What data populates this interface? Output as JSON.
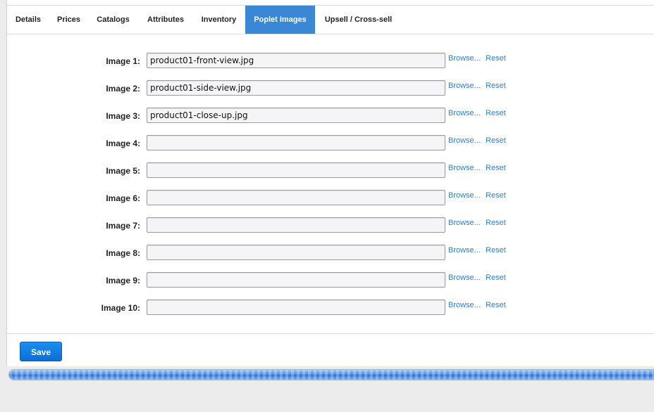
{
  "tabs": [
    {
      "label": "Details",
      "active": false
    },
    {
      "label": "Prices",
      "active": false
    },
    {
      "label": "Catalogs",
      "active": false
    },
    {
      "label": "Attributes",
      "active": false
    },
    {
      "label": "Inventory",
      "active": false
    },
    {
      "label": "Poplet Images",
      "active": true
    },
    {
      "label": "Upsell / Cross-sell",
      "active": false
    }
  ],
  "images": [
    {
      "label": "Image 1:",
      "value": "product01-front-view.jpg",
      "browse": "Browse...",
      "reset": "Reset"
    },
    {
      "label": "Image 2:",
      "value": "product01-side-view.jpg",
      "browse": "Browse...",
      "reset": "Reset"
    },
    {
      "label": "Image 3:",
      "value": "product01-close-up.jpg",
      "browse": "Browse...",
      "reset": "Reset"
    },
    {
      "label": "Image 4:",
      "value": "",
      "browse": "Browse...",
      "reset": "Reset"
    },
    {
      "label": "Image 5:",
      "value": "",
      "browse": "Browse...",
      "reset": "Reset"
    },
    {
      "label": "Image 6:",
      "value": "",
      "browse": "Browse...",
      "reset": "Reset"
    },
    {
      "label": "Image 7:",
      "value": "",
      "browse": "Browse...",
      "reset": "Reset"
    },
    {
      "label": "Image 8:",
      "value": "",
      "browse": "Browse...",
      "reset": "Reset"
    },
    {
      "label": "Image 9:",
      "value": "",
      "browse": "Browse...",
      "reset": "Reset"
    },
    {
      "label": "Image 10:",
      "value": "",
      "browse": "Browse...",
      "reset": "Reset"
    }
  ],
  "save_label": "Save",
  "progress": {
    "fraction": 1.0
  },
  "colors": {
    "accent": "#3a87d6",
    "link": "#2d7fd0",
    "save": "#1a86e8"
  }
}
